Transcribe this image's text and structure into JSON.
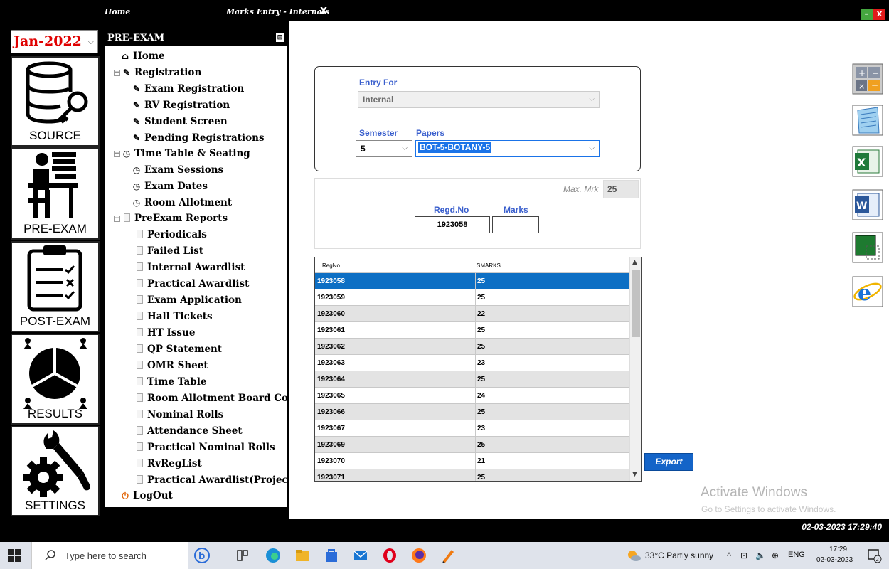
{
  "tabs": {
    "home": "Home",
    "marks_entry": "Marks Entry - Internals",
    "close": "X"
  },
  "window": {
    "minimize": "–",
    "close": "x"
  },
  "month_select": {
    "value": "Jan-2022"
  },
  "modules": [
    {
      "label": "SOURCE"
    },
    {
      "label": "PRE-EXAM"
    },
    {
      "label": "POST-EXAM"
    },
    {
      "label": "RESULTS"
    },
    {
      "label": "SETTINGS"
    }
  ],
  "tree": {
    "header": "PRE-EXAM",
    "pin": "⊟",
    "items": [
      "Home",
      "Registration",
      "Exam Registration",
      "RV Registration",
      "Student Screen",
      "Pending Registrations",
      "Time Table & Seating",
      "Exam Sessions",
      "Exam Dates",
      "Room Allotment",
      "PreExam Reports",
      "Periodicals",
      "Failed List",
      "Internal Awardlist",
      "Practical Awardlist",
      "Exam Application",
      "Hall Tickets",
      "HT Issue",
      "QP Statement",
      "OMR Sheet",
      "Time Table",
      "Room Allotment Board Copy",
      "Nominal Rolls",
      "Attendance Sheet",
      "Practical Nominal Rolls",
      "RvRegList",
      "Practical Awardlist(Project)",
      "LogOut"
    ]
  },
  "form": {
    "entry_for_label": "Entry For",
    "entry_for_value": "Internal",
    "semester_label": "Semester",
    "semester_value": "5",
    "papers_label": "Papers",
    "papers_value": "BOT-5-BOTANY-5",
    "max_marks_label": "Max. Mrk",
    "max_marks_value": "25",
    "regd_no_label": "Regd.No",
    "regd_no_value": "1923058",
    "marks_label": "Marks",
    "marks_value": ""
  },
  "grid": {
    "columns": [
      "RegNo",
      "SMARKS"
    ],
    "rows": [
      [
        "1923058",
        "25"
      ],
      [
        "1923059",
        "25"
      ],
      [
        "1923060",
        "22"
      ],
      [
        "1923061",
        "25"
      ],
      [
        "1923062",
        "25"
      ],
      [
        "1923063",
        "23"
      ],
      [
        "1923064",
        "25"
      ],
      [
        "1923065",
        "24"
      ],
      [
        "1923066",
        "25"
      ],
      [
        "1923067",
        "23"
      ],
      [
        "1923069",
        "25"
      ],
      [
        "1923070",
        "21"
      ],
      [
        "1923071",
        "25"
      ]
    ]
  },
  "export_label": "Export",
  "watermark": {
    "line1": "Activate Windows",
    "line2": "Go to Settings to activate Windows."
  },
  "status_datetime": "02-03-2023 17:29:40",
  "taskbar": {
    "search_placeholder": "Type here to search",
    "weather": "33°C  Partly sunny",
    "lang": "ENG",
    "time": "17:29",
    "date": "02-03-2023",
    "notifications": "2"
  }
}
